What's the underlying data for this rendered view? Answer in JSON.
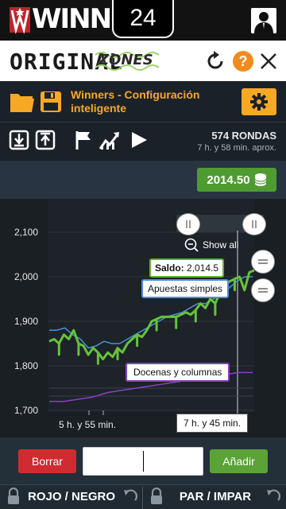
{
  "header": {
    "logo_text": "WINNERS",
    "timer": "24"
  },
  "brand": {
    "word1": "ORIGINAL",
    "word2": "ZONES"
  },
  "config": {
    "title": "Winners - Configuración inteligente"
  },
  "stats": {
    "rounds": "574 RONDAS",
    "time_estimate": "7 h. y 58 min. aprox."
  },
  "balance": {
    "value": "2014.50"
  },
  "chart": {
    "show_all_label": "Show all",
    "saldo_label": "Saldo:",
    "saldo_value": "2,014.5",
    "series1_label": "Apuestas simples",
    "series2_label": "Docenas y columnas",
    "x_left_label": "5 h. y 55 min.",
    "x_cursor_label": "7 h. y 45 min."
  },
  "chart_data": {
    "type": "line",
    "y_ticks": [
      "2,100",
      "2,000",
      "1,900",
      "1,800",
      "1,700"
    ],
    "ylim": [
      1700,
      2100
    ],
    "series": [
      {
        "name": "Saldo",
        "color": "#66c23a"
      },
      {
        "name": "Apuestas simples",
        "color": "#4a90d9"
      },
      {
        "name": "Docenas y columnas",
        "color": "#8a3fc4"
      }
    ],
    "saldo_points": [
      1855,
      1860,
      1850,
      1870,
      1860,
      1880,
      1850,
      1845,
      1825,
      1840,
      1830,
      1815,
      1830,
      1820,
      1840,
      1830,
      1850,
      1860,
      1870,
      1865,
      1880,
      1900,
      1905,
      1910,
      1910,
      1910,
      1910,
      1915,
      1920,
      1915,
      1925,
      1940,
      1930,
      1950,
      1940,
      1965,
      1980,
      1990,
      1995,
      2000,
      1970,
      2010,
      2014.5
    ],
    "apuestas_points": [
      1880,
      1880,
      1885,
      1870,
      1860,
      1840,
      1845,
      1855,
      1850,
      1850,
      1860,
      1870,
      1880,
      1890,
      1900,
      1910,
      1915,
      1920,
      1930,
      1940,
      1940,
      1950,
      1960,
      1975,
      1990,
      2000,
      2000
    ],
    "docenas_points": [
      1720,
      1720,
      1725,
      1730,
      1740,
      1745,
      1750,
      1755,
      1760,
      1765,
      1770,
      1775,
      1780,
      1785,
      1785
    ]
  },
  "buttons": {
    "clear": "Borrar",
    "add": "Añadir",
    "input_value": ""
  },
  "footer": {
    "tab1": "ROJO / NEGRO",
    "tab2": "PAR / IMPAR"
  }
}
